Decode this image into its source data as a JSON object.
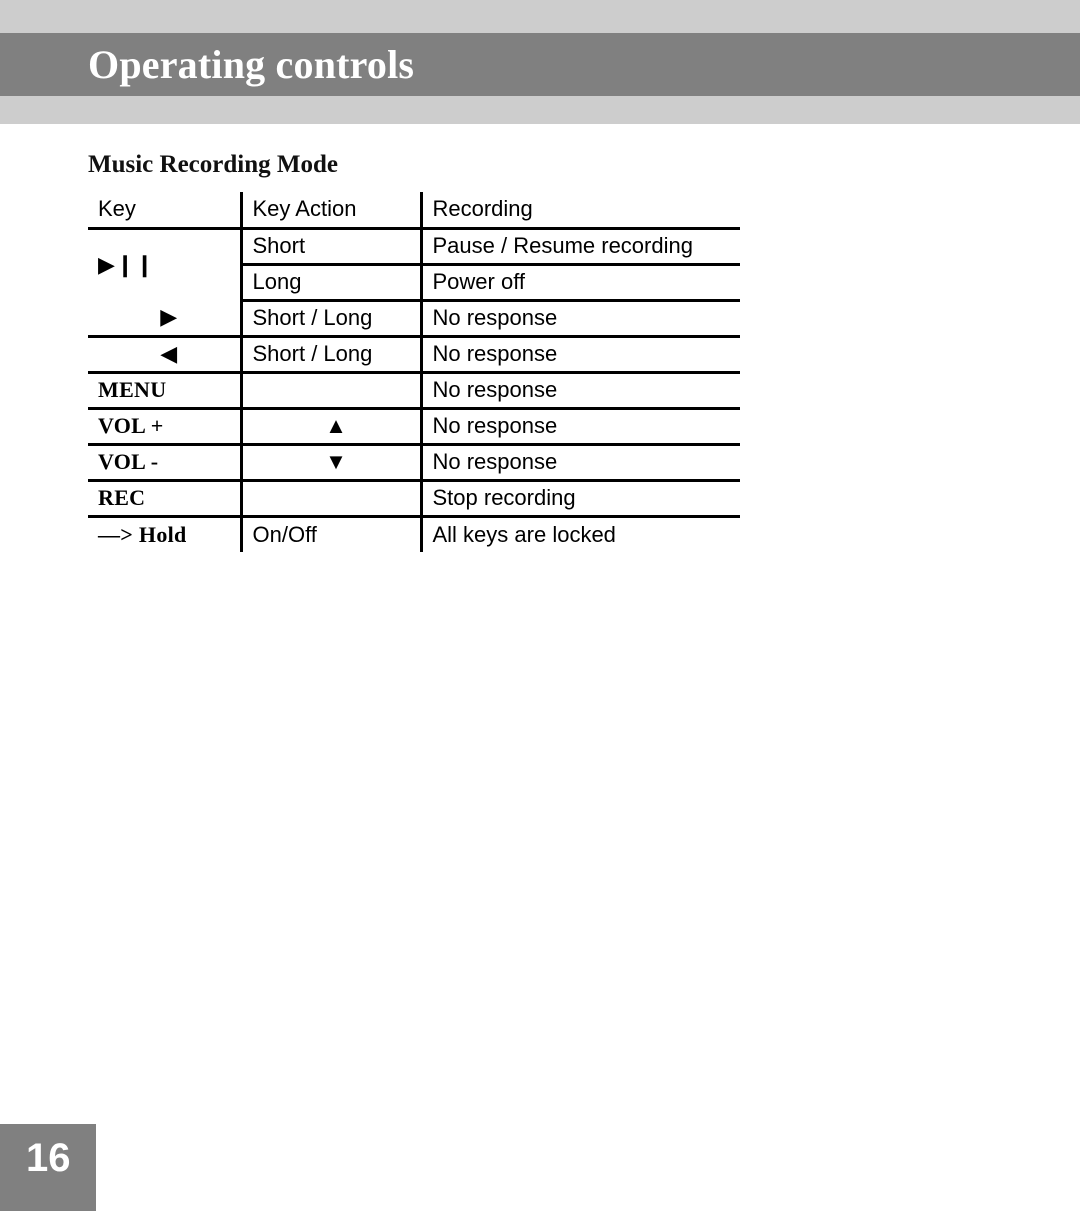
{
  "header": {
    "chapter_title": "Operating controls",
    "band_color_light": "#cdcdcd",
    "band_color_dark": "#808080",
    "title_color": "#ffffff"
  },
  "section": {
    "title": "Music Recording Mode"
  },
  "table": {
    "columns": [
      "Key",
      "Key Action",
      "Recording"
    ],
    "rows": [
      {
        "key": "▶❙❙",
        "key_icon": "play-pause-icon",
        "action": "Short",
        "response": "Pause / Resume recording"
      },
      {
        "key": "",
        "key_icon": "",
        "action": "Long",
        "response": "Power off"
      },
      {
        "key": "▶",
        "key_icon": "next-track-icon",
        "action": "Short / Long",
        "response": "No response"
      },
      {
        "key": "◀",
        "key_icon": "prev-track-icon",
        "action": "Short / Long",
        "response": "No response"
      },
      {
        "key": "MENU",
        "key_icon": "",
        "action": "",
        "response": "No response"
      },
      {
        "key": "VOL +",
        "key_icon": "",
        "action": "▲",
        "action_icon": "up-triangle-icon",
        "response": "No response"
      },
      {
        "key": "VOL -",
        "key_icon": "",
        "action": "▼",
        "action_icon": "down-triangle-icon",
        "response": "No response"
      },
      {
        "key": "REC",
        "key_icon": "",
        "action": "",
        "response": "Stop recording"
      },
      {
        "key": "—> Hold",
        "key_icon": "hold-switch-icon",
        "action": "On/Off",
        "response": "All keys are locked"
      }
    ]
  },
  "footer": {
    "page_number": "16",
    "box_color": "#808080",
    "text_color": "#ffffff"
  }
}
